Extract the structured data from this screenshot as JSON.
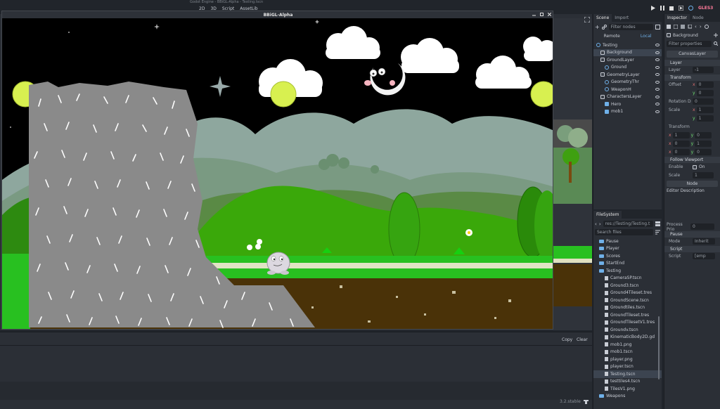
{
  "topbar": {
    "window_title": "Godot Engine - BBiGL-Alpha - Testing.tscn",
    "workspace_tabs": [
      "2D",
      "3D",
      "Script",
      "AssetLib"
    ],
    "renderer": "GLES3"
  },
  "game_window": {
    "title": "BBiGL-Alpha"
  },
  "bottom_panel": {
    "copy_label": "Copy",
    "clear_label": "Clear",
    "version": "3.2.stable"
  },
  "scene_dock": {
    "tabs": [
      "Scene",
      "Import"
    ],
    "filter_placeholder": "Filter nodes",
    "remote_label": "Remote",
    "local_label": "Local",
    "nodes": [
      {
        "label": "Testing",
        "depth": 0,
        "kind": "node2d",
        "selected": false
      },
      {
        "label": "Background",
        "depth": 1,
        "kind": "canvas",
        "selected": true
      },
      {
        "label": "GroundLayer",
        "depth": 1,
        "kind": "canvas",
        "selected": false
      },
      {
        "label": "Ground",
        "depth": 2,
        "kind": "node2d",
        "selected": false
      },
      {
        "label": "GeometryLayer",
        "depth": 1,
        "kind": "canvas",
        "selected": false
      },
      {
        "label": "GeometryThr",
        "depth": 2,
        "kind": "node2d",
        "selected": false
      },
      {
        "label": "WeaponH",
        "depth": 2,
        "kind": "node2d",
        "selected": false
      },
      {
        "label": "CharactersLayer",
        "depth": 1,
        "kind": "canvas",
        "selected": false
      },
      {
        "label": "Hero",
        "depth": 2,
        "kind": "body",
        "selected": false
      },
      {
        "label": "mob1",
        "depth": 2,
        "kind": "body",
        "selected": false
      }
    ]
  },
  "filesystem_dock": {
    "tab": "FileSystem",
    "path": "res://Testing/Testing.t",
    "search_placeholder": "Search files",
    "items": [
      {
        "label": "Pause",
        "type": "folder",
        "depth": 0
      },
      {
        "label": "Player",
        "type": "folder",
        "depth": 0
      },
      {
        "label": "Scores",
        "type": "folder",
        "depth": 0
      },
      {
        "label": "StartEnd",
        "type": "folder",
        "depth": 0
      },
      {
        "label": "Testing",
        "type": "folder",
        "depth": 0
      },
      {
        "label": "CameraSP.tscn",
        "type": "file",
        "depth": 1
      },
      {
        "label": "Ground3.tscn",
        "type": "file",
        "depth": 1
      },
      {
        "label": "Ground4Tileset.tres",
        "type": "file",
        "depth": 1
      },
      {
        "label": "GroundScene.tscn",
        "type": "file",
        "depth": 1
      },
      {
        "label": "Groundtiles.tscn",
        "type": "file",
        "depth": 1
      },
      {
        "label": "GroundTileset.tres",
        "type": "file",
        "depth": 1
      },
      {
        "label": "GroundTilesetV1.tres",
        "type": "file",
        "depth": 1
      },
      {
        "label": "Groundv.tscn",
        "type": "file",
        "depth": 1
      },
      {
        "label": "KinematicBody2D.gd",
        "type": "file",
        "depth": 1
      },
      {
        "label": "mob1.png",
        "type": "file",
        "depth": 1
      },
      {
        "label": "mob1.tscn",
        "type": "file",
        "depth": 1
      },
      {
        "label": "player.png",
        "type": "file",
        "depth": 1
      },
      {
        "label": "player.tscn",
        "type": "file",
        "depth": 1
      },
      {
        "label": "Testing.tscn",
        "type": "file",
        "depth": 1,
        "selected": true
      },
      {
        "label": "testtiles4.tscn",
        "type": "file",
        "depth": 1
      },
      {
        "label": "TilesV1.png",
        "type": "file",
        "depth": 1
      },
      {
        "label": "Weapons",
        "type": "folder",
        "depth": 0
      }
    ]
  },
  "inspector": {
    "tabs": [
      "Inspector",
      "Node"
    ],
    "object_name": "Background",
    "filter_placeholder": "Filter properties",
    "class_name": "CanvasLayer",
    "layer_section": "Layer",
    "layer_label": "Layer",
    "layer_value": "-1",
    "transform_section": "Transform",
    "offset_label": "Offset",
    "offset_x": "0",
    "offset_y": "0",
    "rotation_label": "Rotation D",
    "rotation_value": "0",
    "scale_label": "Scale",
    "scale_x": "1",
    "scale_y": "1",
    "transform2_label": "Transform",
    "t_x1": "1",
    "t_y1": "0",
    "t_x2": "0",
    "t_y2": "1",
    "t_x3": "0",
    "t_y3": "0",
    "follow_section": "Follow Viewport",
    "enable_label": "Enable",
    "enable_value": "On",
    "fscale_label": "Scale",
    "fscale_value": "1",
    "node_section": "Node",
    "editor_desc_label": "Editor Description",
    "process_label": "Process Prio",
    "process_value": "0",
    "pause_section": "Pause",
    "mode_label": "Mode",
    "mode_value": "Inherit",
    "script_section": "Script",
    "script_label": "Script",
    "script_value": "[emp"
  },
  "colors": {
    "panel": "#2b2f36",
    "accent": "#6fb0e8",
    "grass": "#3aa80a",
    "rock": "#8a8a8a",
    "sun": "#d8f050"
  }
}
